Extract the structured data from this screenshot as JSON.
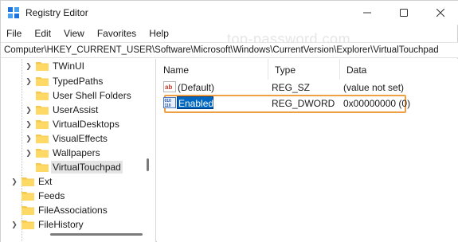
{
  "window": {
    "title": "Registry Editor",
    "accent_color": "#0067c0",
    "highlight_color": "#f0a044"
  },
  "menu": [
    "File",
    "Edit",
    "View",
    "Favorites",
    "Help"
  ],
  "watermark": "top-password.com",
  "address": "Computer\\HKEY_CURRENT_USER\\Software\\Microsoft\\Windows\\CurrentVersion\\Explorer\\VirtualTouchpad",
  "tree": {
    "items": [
      {
        "label": "TWinUI",
        "expandable": true,
        "selected": false
      },
      {
        "label": "TypedPaths",
        "expandable": true,
        "selected": false
      },
      {
        "label": "User Shell Folders",
        "expandable": false,
        "selected": false
      },
      {
        "label": "UserAssist",
        "expandable": true,
        "selected": false
      },
      {
        "label": "VirtualDesktops",
        "expandable": true,
        "selected": false
      },
      {
        "label": "VisualEffects",
        "expandable": true,
        "selected": false
      },
      {
        "label": "Wallpapers",
        "expandable": true,
        "selected": false
      },
      {
        "label": "VirtualTouchpad",
        "expandable": false,
        "selected": true
      },
      {
        "label": "Ext",
        "expandable": true,
        "selected": false
      },
      {
        "label": "Feeds",
        "expandable": false,
        "selected": false
      },
      {
        "label": "FileAssociations",
        "expandable": false,
        "selected": false
      },
      {
        "label": "FileHistory",
        "expandable": true,
        "selected": false
      }
    ]
  },
  "list": {
    "columns": {
      "name": "Name",
      "type": "Type",
      "data": "Data"
    },
    "rows": [
      {
        "icon": "string-value-icon",
        "name": "(Default)",
        "type": "REG_SZ",
        "data": "(value not set)"
      },
      {
        "icon": "dword-value-icon",
        "name": "Enabled",
        "type": "REG_DWORD",
        "data": "0x00000000 (0)"
      }
    ]
  }
}
